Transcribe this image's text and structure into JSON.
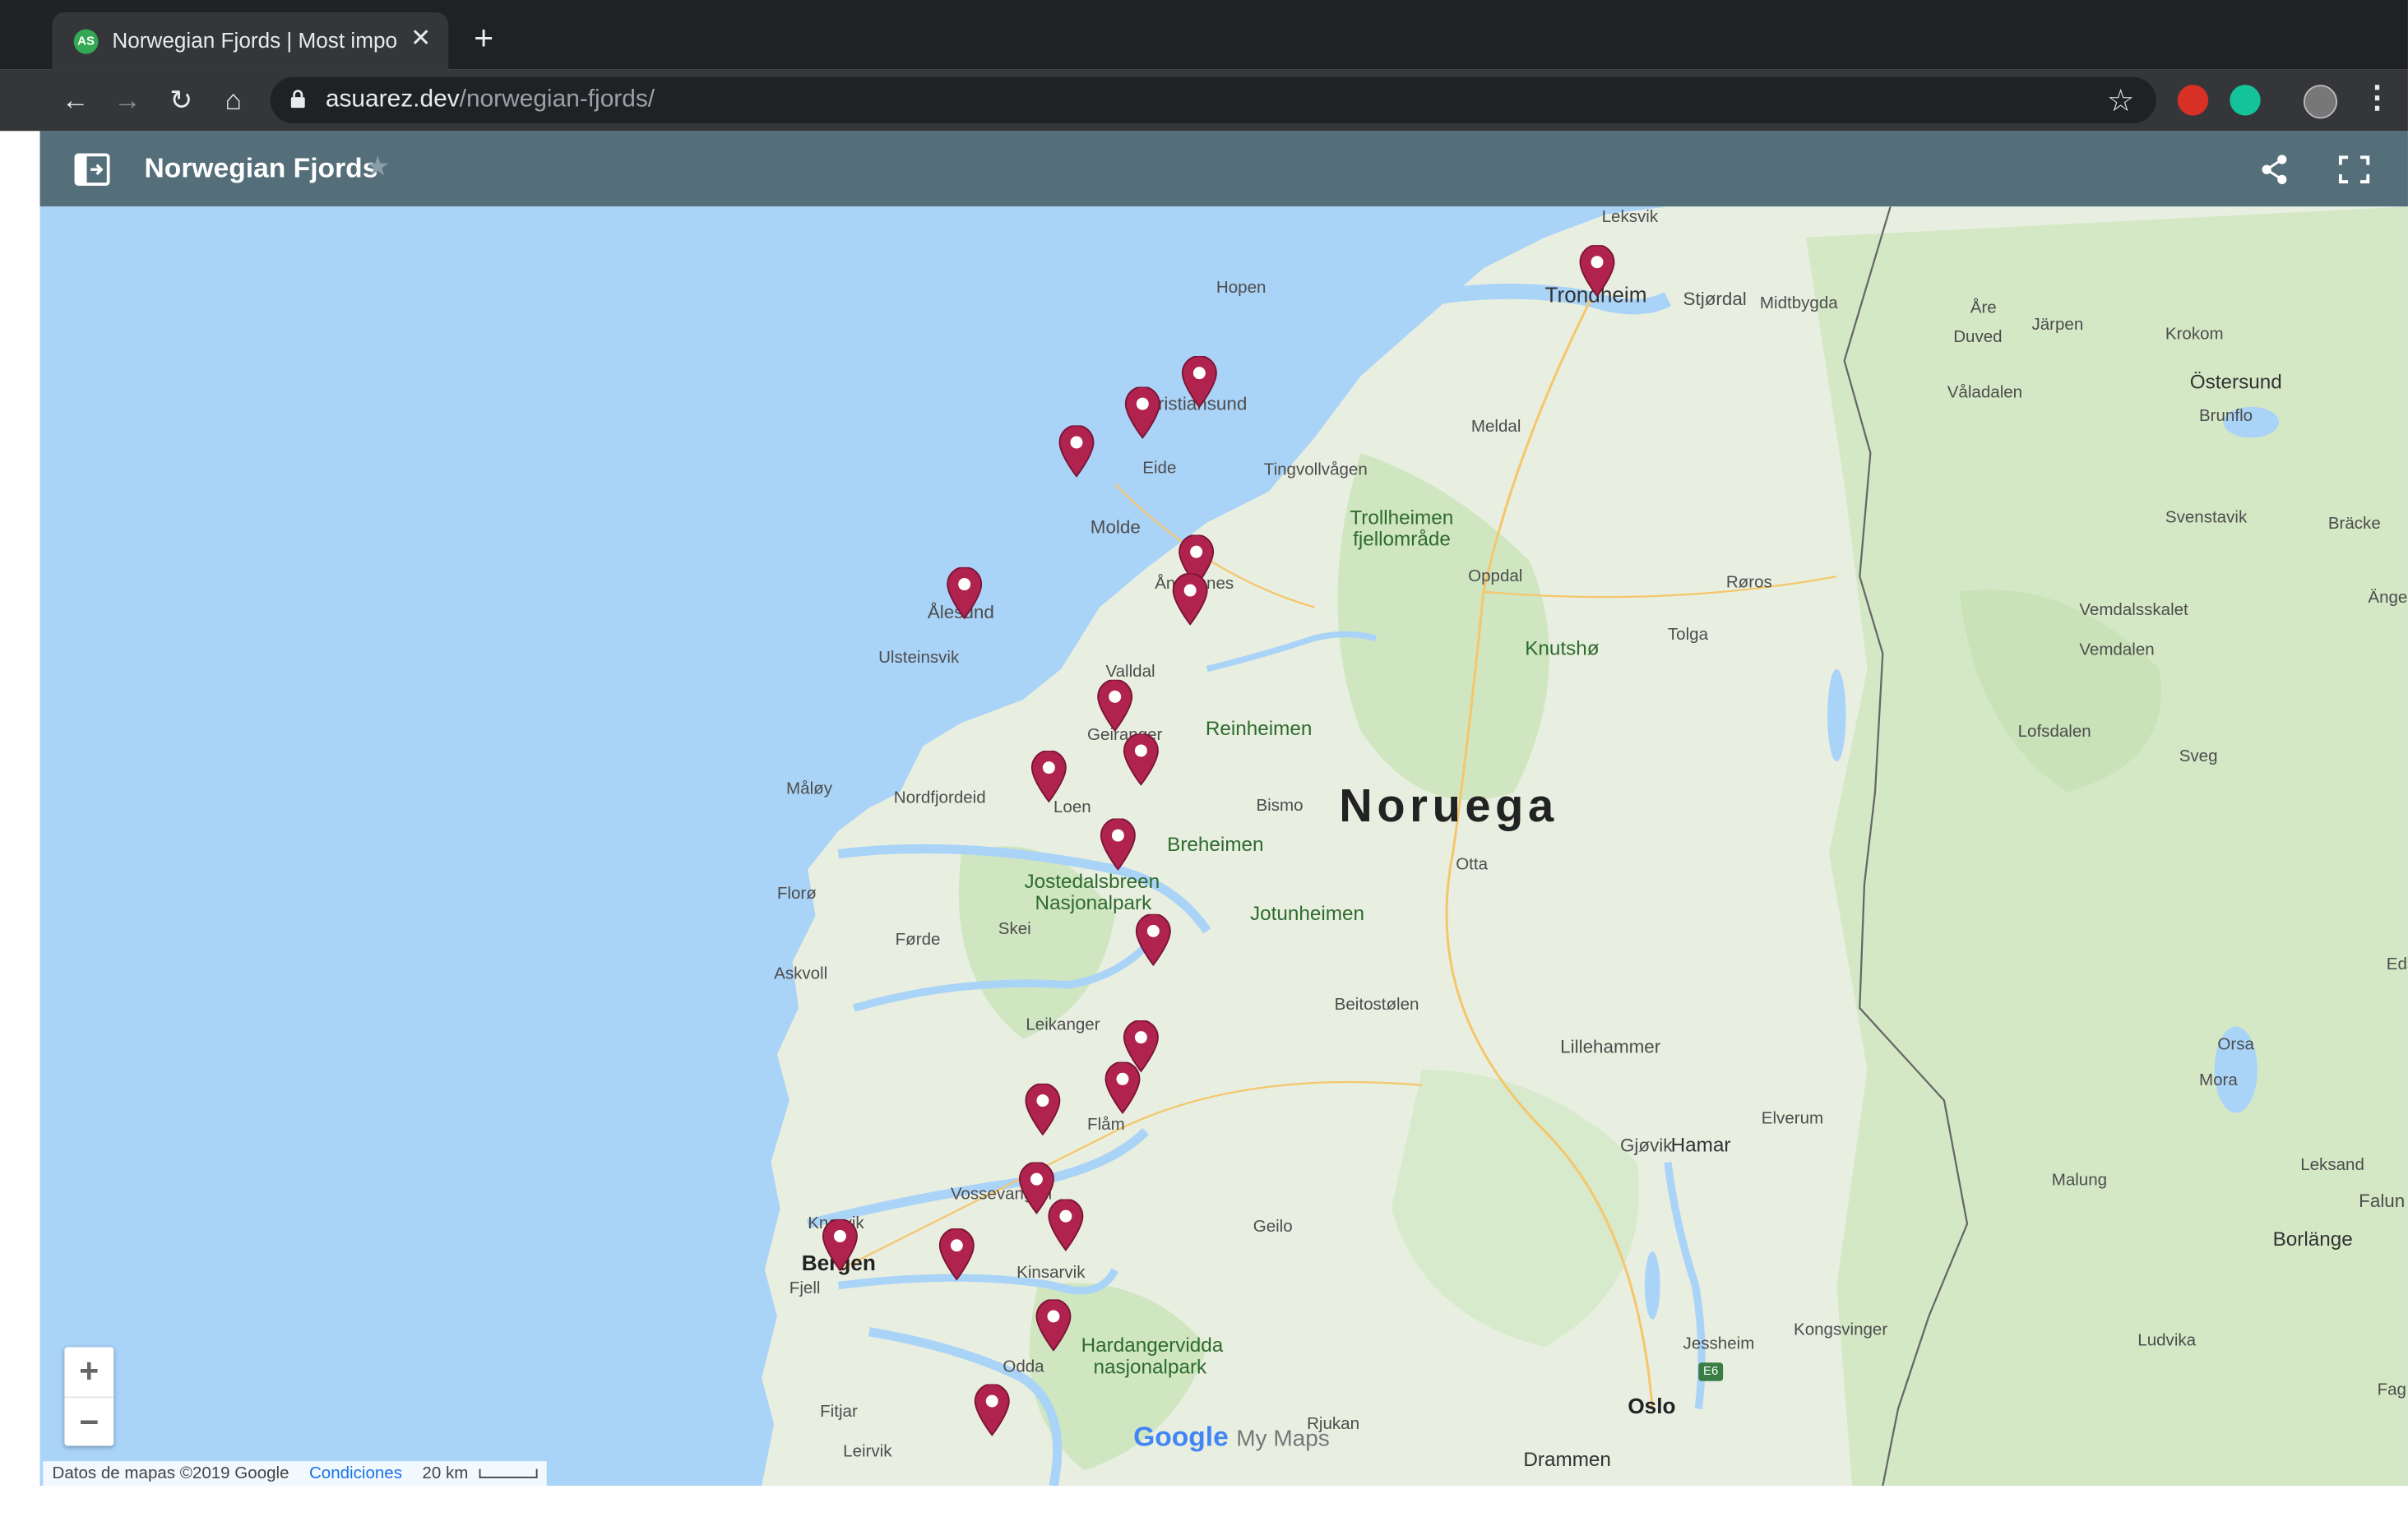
{
  "browser": {
    "tab_title": "Norwegian Fjords | Most impor",
    "tab_favicon_text": "AS",
    "url_host": "asuarez.dev",
    "url_path": "/norwegian-fjords/"
  },
  "mymaps": {
    "title": "Norwegian Fjords"
  },
  "map": {
    "country_label": "Noruega",
    "places": [
      "Leksvik",
      "Hopen",
      "Trondheim",
      "Stjørdal",
      "Midtbygda",
      "Åre",
      "Duved",
      "Järpen",
      "Krokom",
      "Östersund",
      "Brunflo",
      "Våladalen",
      "Kristiansund",
      "Eide",
      "Meldal",
      "Tingvollvågen",
      "Molde",
      "Trollheimen",
      "fjellområde",
      "Åndalsnes",
      "Oppdal",
      "Røros",
      "Svenstavik",
      "Bräcke",
      "Ålesund",
      "Ulsteinsvik",
      "Knutshø",
      "Tolga",
      "Vemdalsskalet",
      "Vemdalen",
      "Valldal",
      "Geiranger",
      "Reinheimen",
      "Lofsdalen",
      "Sveg",
      "Måløy",
      "Nordfjordeid",
      "Loen",
      "Bismo",
      "Breheimen",
      "Otta",
      "Jostedalsbreen",
      "Nasjonalpark",
      "Florø",
      "Jotunheimen",
      "Førde",
      "Skei",
      "Askvoll",
      "Beitostølen",
      "Leikanger",
      "Lillehammer",
      "Orsa",
      "Mora",
      "Flåm",
      "Elverum",
      "Gjøvik",
      "Hamar",
      "Vossevangen",
      "Leksand",
      "Knarvik",
      "Geilo",
      "Malung",
      "Bergen",
      "Fjell",
      "Kinsarvik",
      "Borlänge",
      "Hardangervidda",
      "nasjonalpark",
      "Odda",
      "Jessheim",
      "Kongsvinger",
      "Ludvika",
      "Fitjar",
      "Rjukan",
      "Oslo",
      "Leirvik",
      "Drammen",
      "Falun",
      "Änge",
      "Eds",
      "Fag"
    ],
    "markers": [
      "marker",
      "marker",
      "marker",
      "marker",
      "marker",
      "marker",
      "marker",
      "marker",
      "marker",
      "marker",
      "marker",
      "marker",
      "marker",
      "marker",
      "marker",
      "marker",
      "marker",
      "marker",
      "marker",
      "marker"
    ],
    "zoom_in": "+",
    "zoom_out": "−",
    "attribution": "Datos de mapas ©2019 Google",
    "terms": "Condiciones",
    "scale": "20 km",
    "logo_google": "Google",
    "logo_mymaps": "My Maps",
    "road_shield": "E6"
  },
  "colors": {
    "header": "#546e7a",
    "water": "#aad3f8",
    "land": "#e8efe0",
    "forest": "#cfe6c1",
    "pin": "#b0234f"
  }
}
